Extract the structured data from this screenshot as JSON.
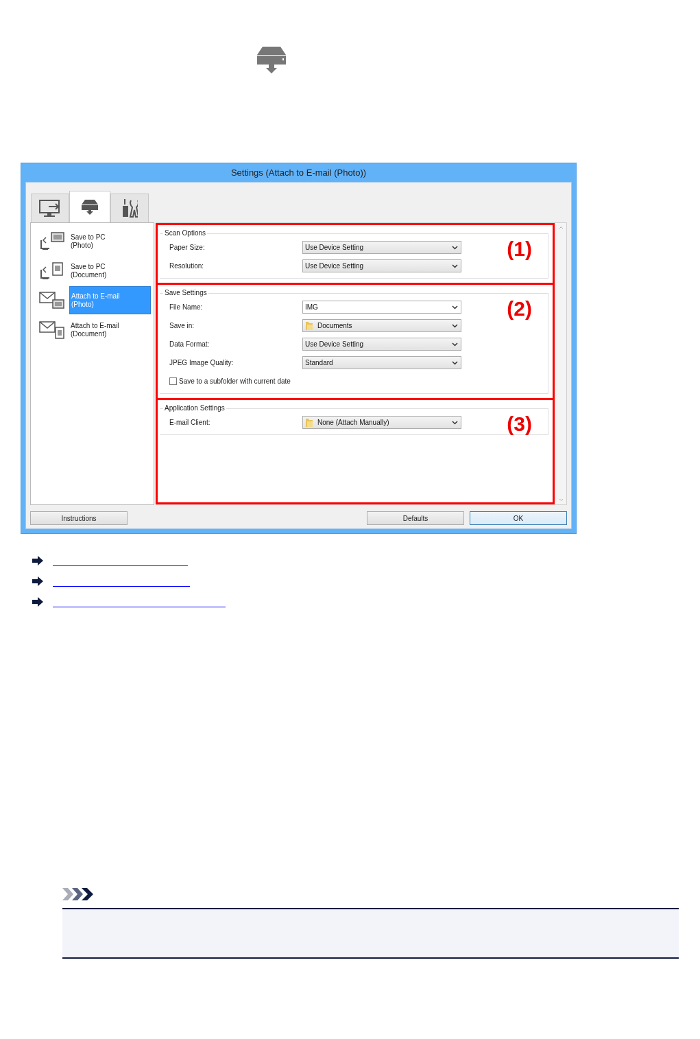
{
  "dialog": {
    "title": "Settings (Attach to E-mail (Photo))",
    "tabs": [
      {
        "kind": "monitor",
        "selected": false
      },
      {
        "kind": "scanner",
        "selected": true
      },
      {
        "kind": "tools",
        "selected": false
      }
    ],
    "scan_list": [
      {
        "kind": "pc-photo",
        "label": "Save to PC",
        "sublabel": "(Photo)",
        "selected": false
      },
      {
        "kind": "pc-document",
        "label": "Save to PC",
        "sublabel": "(Document)",
        "selected": false
      },
      {
        "kind": "mail-photo",
        "label": "Attach to E-mail",
        "sublabel": "(Photo)",
        "selected": true
      },
      {
        "kind": "mail-document",
        "label": "Attach to E-mail",
        "sublabel": "(Document)",
        "selected": false
      }
    ],
    "sections": [
      {
        "legend": "Scan Options",
        "callout": "(1)",
        "fields": [
          {
            "kind": "select",
            "label": "Paper Size:",
            "value": "Use Device Setting"
          },
          {
            "kind": "select",
            "label": "Resolution:",
            "value": "Use Device Setting"
          }
        ]
      },
      {
        "legend": "Save Settings",
        "callout": "(2)",
        "fields": [
          {
            "kind": "select",
            "label": "File Name:",
            "value": "IMG",
            "editable": true
          },
          {
            "kind": "folder-select",
            "label": "Save in:",
            "value": "Documents"
          },
          {
            "kind": "select",
            "label": "Data Format:",
            "value": "Use Device Setting"
          },
          {
            "kind": "select",
            "label": "JPEG Image Quality:",
            "value": "Standard"
          },
          {
            "kind": "checkbox",
            "label": "Save to a subfolder with current date",
            "checked": false
          }
        ]
      },
      {
        "legend": "Application Settings",
        "callout": "(3)",
        "fields": [
          {
            "kind": "folder-select",
            "label": "E-mail Client:",
            "value": "None (Attach Manually)"
          }
        ]
      }
    ],
    "buttons": [
      {
        "label": "Instructions",
        "default": false
      },
      {
        "label": "Defaults",
        "default": false
      },
      {
        "label": "OK",
        "default": true
      }
    ]
  },
  "links": [
    {
      "kind": "link"
    },
    {
      "kind": "link"
    },
    {
      "kind": "link"
    }
  ],
  "note": {
    "kind": "note"
  }
}
